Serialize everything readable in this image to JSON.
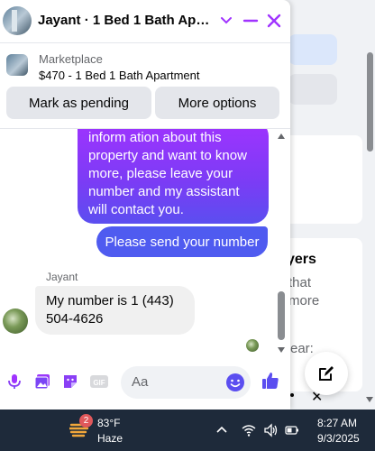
{
  "chat": {
    "title": "Jayant · 1 Bed 1 Bath Apart…",
    "listing": {
      "market": "Marketplace",
      "title": "$470 - 1 Bed 1 Bath Apartment"
    },
    "actions": {
      "pending": "Mark as pending",
      "more": "More options"
    },
    "messages": {
      "outgoing_long": [
        "inform      ation about this",
        "property and want to know",
        "more, please leave your",
        "number and my assistant",
        "will contact you."
      ],
      "outgoing_short": "Please send your number",
      "sender": "Jayant",
      "incoming": [
        "My number is 1 (443)",
        "504-4626"
      ]
    },
    "composer": {
      "placeholder": "Aa"
    }
  },
  "background": {
    "heading": "yers",
    "line1": "that",
    "line2": "more",
    "line3": "ear:"
  },
  "taskbar": {
    "weather_badge": "2",
    "temp": "83°F",
    "condition": "Haze",
    "time": "8:27 AM",
    "date": "9/3/2025"
  },
  "colors": {
    "accent": "#a033ff",
    "bubble_blue": "#4f5bf0",
    "taskbar": "#1e2a3a"
  }
}
